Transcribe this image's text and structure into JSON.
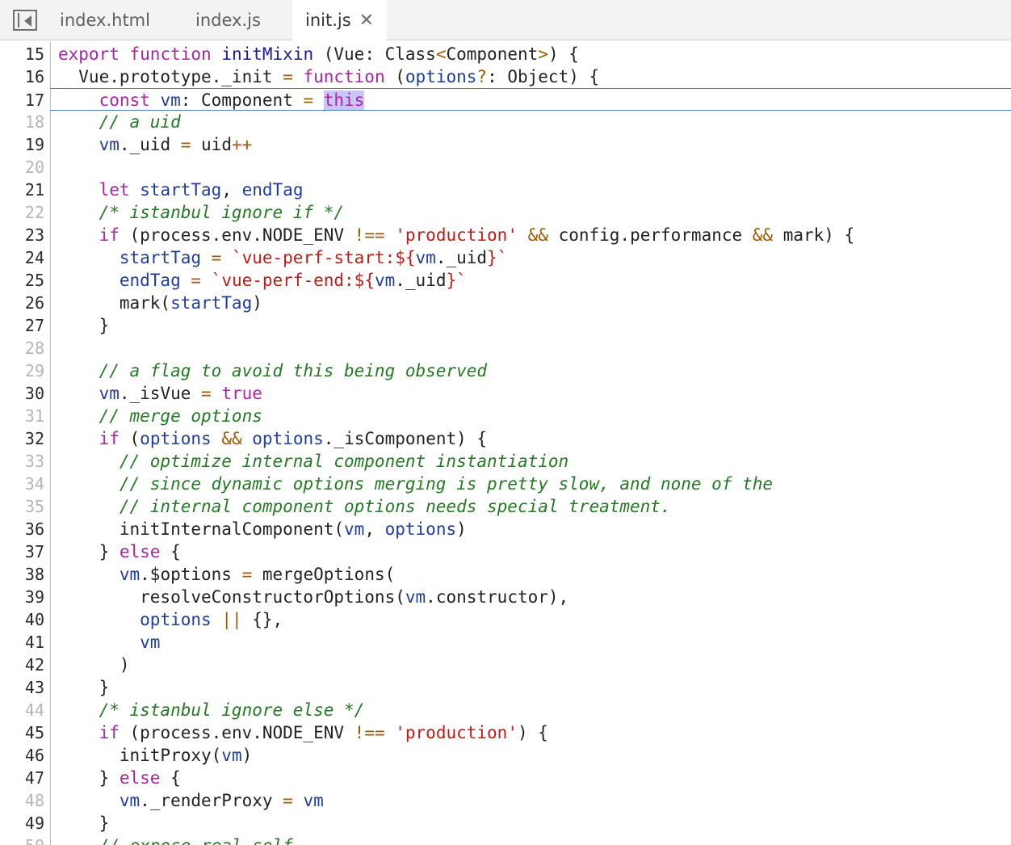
{
  "tabs": [
    {
      "label": "index.html"
    },
    {
      "label": "index.js"
    },
    {
      "label": "init.js",
      "close": "✕"
    }
  ],
  "editor": {
    "lines": [
      {
        "n": "15",
        "segs": [
          [
            "kw",
            "export "
          ],
          [
            "kw",
            "function "
          ],
          [
            "fn",
            "initMixin "
          ],
          [
            "pl",
            "(Vue: Class"
          ],
          [
            "op",
            "<"
          ],
          [
            "pl",
            "Component"
          ],
          [
            "op",
            ">"
          ],
          [
            "pl",
            ") {"
          ]
        ]
      },
      {
        "n": "16",
        "segs": [
          [
            "pl",
            "  Vue.prototype._init "
          ],
          [
            "op",
            "= "
          ],
          [
            "kw",
            "function "
          ],
          [
            "pl",
            "("
          ],
          [
            "va",
            "options"
          ],
          [
            "op",
            "?"
          ],
          [
            "pl",
            ": Object) {"
          ]
        ]
      },
      {
        "n": "17",
        "segs": [
          [
            "pl",
            "    "
          ],
          [
            "kw",
            "const "
          ],
          [
            "va",
            "vm"
          ],
          [
            "pl",
            ": Component "
          ],
          [
            "op",
            "= "
          ],
          [
            "caret",
            ""
          ],
          [
            "sel",
            "this"
          ]
        ]
      },
      {
        "n": "18",
        "segs": [
          [
            "cm",
            "    // a uid"
          ]
        ]
      },
      {
        "n": "19",
        "segs": [
          [
            "pl",
            "    "
          ],
          [
            "va",
            "vm"
          ],
          [
            "pl",
            "._uid "
          ],
          [
            "op",
            "= "
          ],
          [
            "pl",
            "uid"
          ],
          [
            "op",
            "++"
          ]
        ]
      },
      {
        "n": "20",
        "segs": []
      },
      {
        "n": "21",
        "segs": [
          [
            "pl",
            "    "
          ],
          [
            "kw",
            "let "
          ],
          [
            "va",
            "startTag"
          ],
          [
            "pl",
            ", "
          ],
          [
            "va",
            "endTag"
          ]
        ]
      },
      {
        "n": "22",
        "segs": [
          [
            "cm",
            "    /* istanbul ignore if */"
          ]
        ]
      },
      {
        "n": "23",
        "segs": [
          [
            "pl",
            "    "
          ],
          [
            "kw",
            "if "
          ],
          [
            "pl",
            "(process.env.NODE_ENV "
          ],
          [
            "op",
            "!== "
          ],
          [
            "str",
            "'production' "
          ],
          [
            "op",
            "&& "
          ],
          [
            "pl",
            "config.performance "
          ],
          [
            "op",
            "&& "
          ],
          [
            "pl",
            "mark) {"
          ]
        ]
      },
      {
        "n": "24",
        "segs": [
          [
            "pl",
            "      "
          ],
          [
            "va",
            "startTag "
          ],
          [
            "op",
            "= "
          ],
          [
            "str",
            "`vue-perf-start:${"
          ],
          [
            "va",
            "vm"
          ],
          [
            "pl",
            "._uid"
          ],
          [
            "str",
            "}`"
          ]
        ]
      },
      {
        "n": "25",
        "segs": [
          [
            "pl",
            "      "
          ],
          [
            "va",
            "endTag "
          ],
          [
            "op",
            "= "
          ],
          [
            "str",
            "`vue-perf-end:${"
          ],
          [
            "va",
            "vm"
          ],
          [
            "pl",
            "._uid"
          ],
          [
            "str",
            "}`"
          ]
        ]
      },
      {
        "n": "26",
        "segs": [
          [
            "pl",
            "      mark("
          ],
          [
            "va",
            "startTag"
          ],
          [
            "pl",
            ")"
          ]
        ]
      },
      {
        "n": "27",
        "segs": [
          [
            "pl",
            "    }"
          ]
        ]
      },
      {
        "n": "28",
        "segs": []
      },
      {
        "n": "29",
        "segs": [
          [
            "cm",
            "    // a flag to avoid this being observed"
          ]
        ]
      },
      {
        "n": "30",
        "segs": [
          [
            "pl",
            "    "
          ],
          [
            "va",
            "vm"
          ],
          [
            "pl",
            "._isVue "
          ],
          [
            "op",
            "= "
          ],
          [
            "kw",
            "true"
          ]
        ]
      },
      {
        "n": "31",
        "segs": [
          [
            "cm",
            "    // merge options"
          ]
        ]
      },
      {
        "n": "32",
        "segs": [
          [
            "pl",
            "    "
          ],
          [
            "kw",
            "if "
          ],
          [
            "pl",
            "("
          ],
          [
            "va",
            "options "
          ],
          [
            "op",
            "&& "
          ],
          [
            "va",
            "options"
          ],
          [
            "pl",
            "._isComponent) {"
          ]
        ]
      },
      {
        "n": "33",
        "segs": [
          [
            "cm",
            "      // optimize internal component instantiation"
          ]
        ]
      },
      {
        "n": "34",
        "segs": [
          [
            "cm",
            "      // since dynamic options merging is pretty slow, and none of the"
          ]
        ]
      },
      {
        "n": "35",
        "segs": [
          [
            "cm",
            "      // internal component options needs special treatment."
          ]
        ]
      },
      {
        "n": "36",
        "segs": [
          [
            "pl",
            "      initInternalComponent("
          ],
          [
            "va",
            "vm"
          ],
          [
            "pl",
            ", "
          ],
          [
            "va",
            "options"
          ],
          [
            "pl",
            ")"
          ]
        ]
      },
      {
        "n": "37",
        "segs": [
          [
            "pl",
            "    } "
          ],
          [
            "kw",
            "else "
          ],
          [
            "pl",
            "{"
          ]
        ]
      },
      {
        "n": "38",
        "segs": [
          [
            "pl",
            "      "
          ],
          [
            "va",
            "vm"
          ],
          [
            "pl",
            ".$options "
          ],
          [
            "op",
            "= "
          ],
          [
            "pl",
            "mergeOptions("
          ]
        ]
      },
      {
        "n": "39",
        "segs": [
          [
            "pl",
            "        resolveConstructorOptions("
          ],
          [
            "va",
            "vm"
          ],
          [
            "pl",
            ".constructor),"
          ]
        ]
      },
      {
        "n": "40",
        "segs": [
          [
            "pl",
            "        "
          ],
          [
            "va",
            "options "
          ],
          [
            "op",
            "|| "
          ],
          [
            "pl",
            "{},"
          ]
        ]
      },
      {
        "n": "41",
        "segs": [
          [
            "pl",
            "        "
          ],
          [
            "va",
            "vm"
          ]
        ]
      },
      {
        "n": "42",
        "segs": [
          [
            "pl",
            "      )"
          ]
        ]
      },
      {
        "n": "43",
        "segs": [
          [
            "pl",
            "    }"
          ]
        ]
      },
      {
        "n": "44",
        "segs": [
          [
            "cm",
            "    /* istanbul ignore else */"
          ]
        ]
      },
      {
        "n": "45",
        "segs": [
          [
            "pl",
            "    "
          ],
          [
            "kw",
            "if "
          ],
          [
            "pl",
            "(process.env.NODE_ENV "
          ],
          [
            "op",
            "!== "
          ],
          [
            "str",
            "'production'"
          ],
          [
            "pl",
            ") {"
          ]
        ]
      },
      {
        "n": "46",
        "segs": [
          [
            "pl",
            "      initProxy("
          ],
          [
            "va",
            "vm"
          ],
          [
            "pl",
            ")"
          ]
        ]
      },
      {
        "n": "47",
        "segs": [
          [
            "pl",
            "    } "
          ],
          [
            "kw",
            "else "
          ],
          [
            "pl",
            "{"
          ]
        ]
      },
      {
        "n": "48",
        "segs": [
          [
            "pl",
            "      "
          ],
          [
            "va",
            "vm"
          ],
          [
            "pl",
            "._renderProxy "
          ],
          [
            "op",
            "= "
          ],
          [
            "va",
            "vm"
          ]
        ]
      },
      {
        "n": "49",
        "segs": [
          [
            "pl",
            "    }"
          ]
        ]
      },
      {
        "n": "50",
        "segs": [
          [
            "cm",
            "    // expose real self"
          ]
        ]
      }
    ]
  }
}
